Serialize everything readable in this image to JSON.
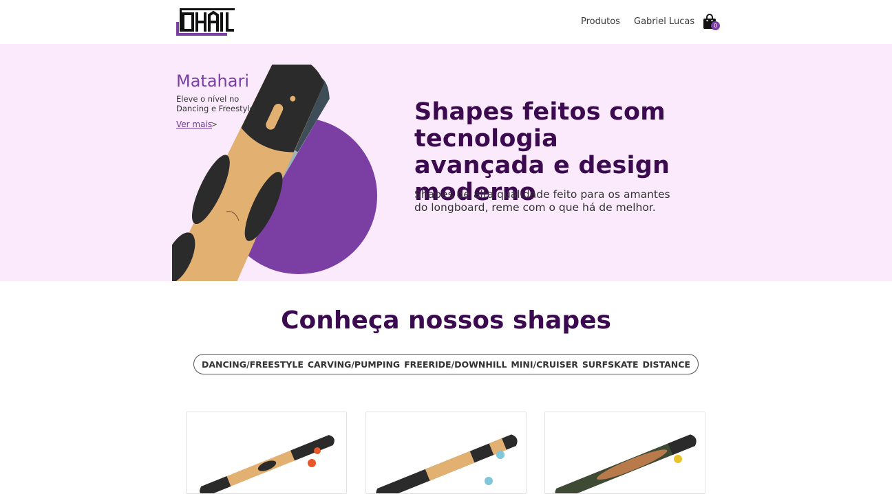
{
  "header": {
    "logo_text": "OHAI",
    "nav": {
      "products": "Produtos",
      "user": "Gabriel Lucas"
    },
    "cart": {
      "icon": "shopping-bag-icon",
      "count": "0"
    }
  },
  "hero": {
    "promo": {
      "name": "Matahari",
      "description": "Eleve o nível no Dancing e Freestyle",
      "link": "Ver mais",
      "link_arrow": ">"
    },
    "title": "Shapes feitos com tecnologia avançada e design moderno",
    "subtitle": "Shapes de alta qualidade feito para os amantes do longboard, reme com o que há de melhor."
  },
  "shapes": {
    "title": "Conheça nossos shapes",
    "filters": [
      "DANCING/FREESTYLE",
      "CARVING/PUMPING",
      "FREERIDE/DOWNHILL",
      "MINI/CRUISER",
      "SURFSKATE",
      "DISTANCE"
    ]
  },
  "colors": {
    "accent": "#7b3fa3",
    "hero_bg": "#faeafc",
    "title": "#3b0a4f"
  }
}
